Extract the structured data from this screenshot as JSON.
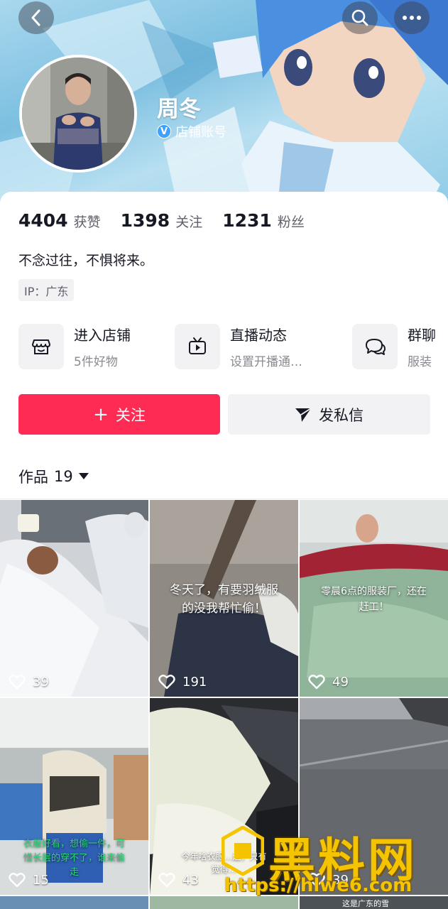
{
  "profile": {
    "name": "周冬",
    "verify_label": "店铺账号",
    "verify_badge": "V",
    "bio": "不念过往，不惧将来。",
    "ip_location": "IP：广东"
  },
  "stats": [
    {
      "value": "4404",
      "label": "获赞"
    },
    {
      "value": "1398",
      "label": "关注"
    },
    {
      "value": "1231",
      "label": "粉丝"
    }
  ],
  "features": [
    {
      "title": "进入店铺",
      "subtitle": "5件好物",
      "icon": "store-icon"
    },
    {
      "title": "直播动态",
      "subtitle": "设置开播通…",
      "icon": "tv-icon"
    },
    {
      "title": "群聊",
      "subtitle": "服装",
      "icon": "chat-bubbles-icon"
    }
  ],
  "actions": {
    "follow_icon": "+",
    "follow_label": "关注",
    "message_label": "发私信"
  },
  "works": {
    "label": "作品",
    "count": "19"
  },
  "videos": [
    {
      "likes": "39",
      "caption": ""
    },
    {
      "likes": "191",
      "caption": "冬天了，有要羽绒服的没我帮忙偷！"
    },
    {
      "likes": "49",
      "caption": "零晨6点的服装厂，还在赶工！"
    },
    {
      "likes": "15",
      "caption": "衣服好看，想偷一件，可惜长层的穿不了，谁来偷走"
    },
    {
      "likes": "43",
      "caption": "今年啥衣服…边，只有觉得…"
    },
    {
      "likes": "39",
      "caption": ""
    }
  ],
  "bottom_partial_caption": "这是广东的雪",
  "watermark": {
    "text": "黑料网",
    "url": "https://hlwe6.com"
  },
  "colors": {
    "accent": "#fe2c55",
    "verify": "#3ea0ff",
    "watermark": "#f5c400"
  }
}
